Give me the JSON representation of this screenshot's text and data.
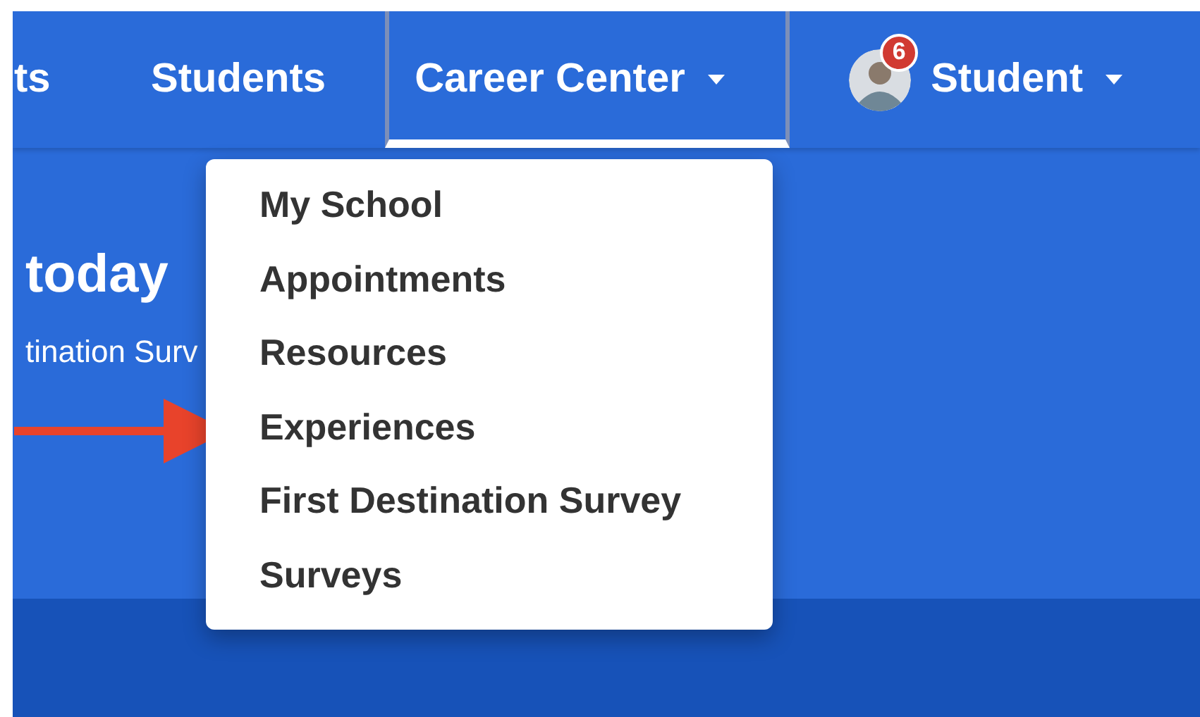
{
  "nav": {
    "items": [
      {
        "label": "ts",
        "kind": "link",
        "selected": false
      },
      {
        "label": "Students",
        "kind": "link",
        "selected": false
      },
      {
        "label": "Career Center",
        "kind": "menu",
        "selected": true
      },
      {
        "label": "Student",
        "kind": "user",
        "selected": false,
        "badge": "6"
      }
    ]
  },
  "hero": {
    "title": "today",
    "subtitle": "tination Surv"
  },
  "dropdown": {
    "open": true,
    "items": [
      {
        "label": "My School"
      },
      {
        "label": "Appointments"
      },
      {
        "label": "Resources"
      },
      {
        "label": "Experiences"
      },
      {
        "label": "First Destination Survey"
      },
      {
        "label": "Surveys"
      }
    ]
  }
}
